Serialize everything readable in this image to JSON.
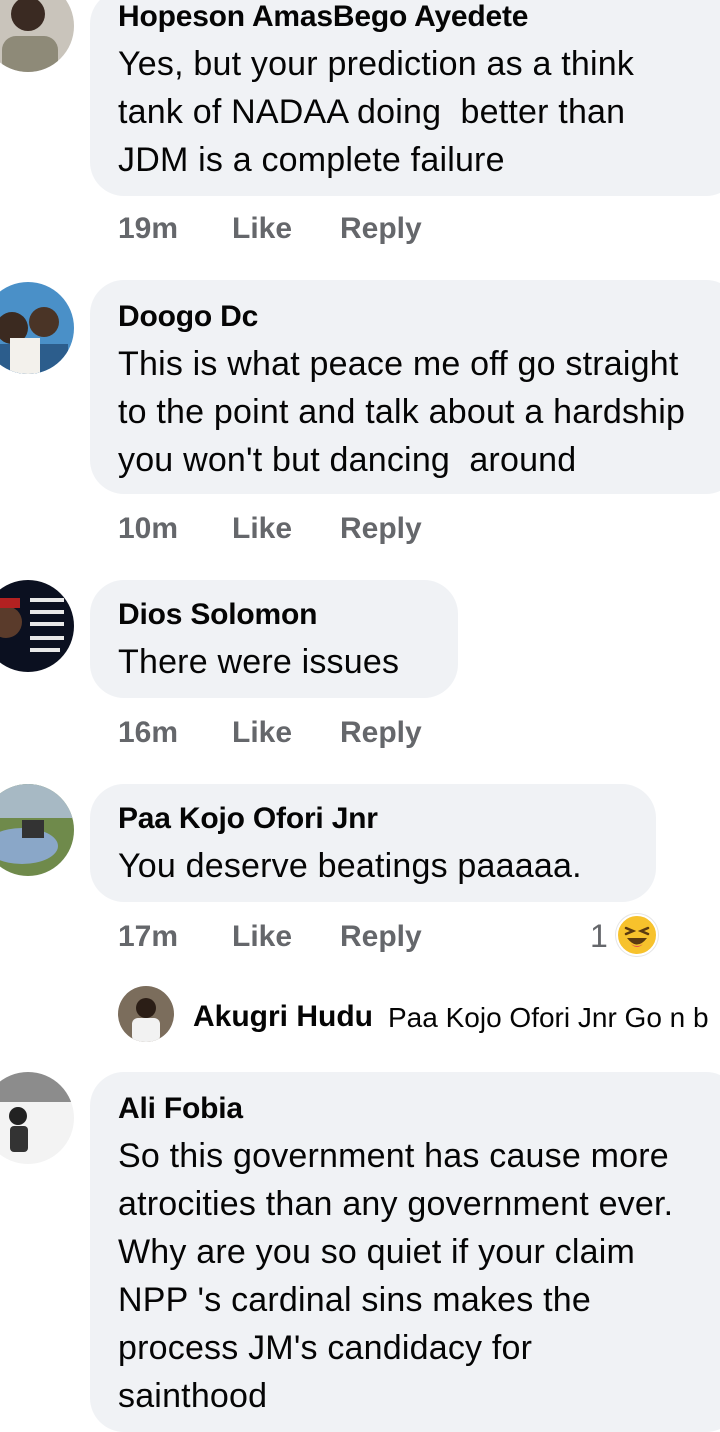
{
  "comments": [
    {
      "name": "Hopeson AmasBego Ayedete",
      "lines": [
        "Yes, but your prediction as a think",
        "tank of NADAA doing  better than",
        "JDM is a complete failure"
      ],
      "time": "19m",
      "like": "Like",
      "reply": "Reply"
    },
    {
      "name": "Doogo Dc",
      "lines": [
        "This is what peace me off go straight",
        "to the point and talk about a hardship",
        "you won't but dancing  around"
      ],
      "time": "10m",
      "like": "Like",
      "reply": "Reply"
    },
    {
      "name": "Dios Solomon",
      "lines": [
        "There were issues"
      ],
      "time": "16m",
      "like": "Like",
      "reply": "Reply"
    },
    {
      "name": "Paa Kojo Ofori Jnr",
      "lines": [
        "You deserve beatings paaaaa."
      ],
      "time": "17m",
      "like": "Like",
      "reply": "Reply",
      "reaction_count": "1",
      "reaction_icon": "laughing-face-icon"
    },
    {
      "name": "Ali Fobia",
      "lines": [
        "So this government has cause more",
        "atrocities than any government ever.",
        "Why are you so quiet if your claim",
        "NPP 's cardinal sins makes the",
        "process JM's candidacy for",
        "sainthood"
      ]
    }
  ],
  "reply_preview": {
    "name": "Akugri Hudu",
    "text": "Paa Kojo Ofori Jnr Go n b"
  },
  "colors": {
    "bubble": "#f0f2f5",
    "meta_text": "#65676b",
    "text": "#050505",
    "emoji": "#f7c22c"
  }
}
